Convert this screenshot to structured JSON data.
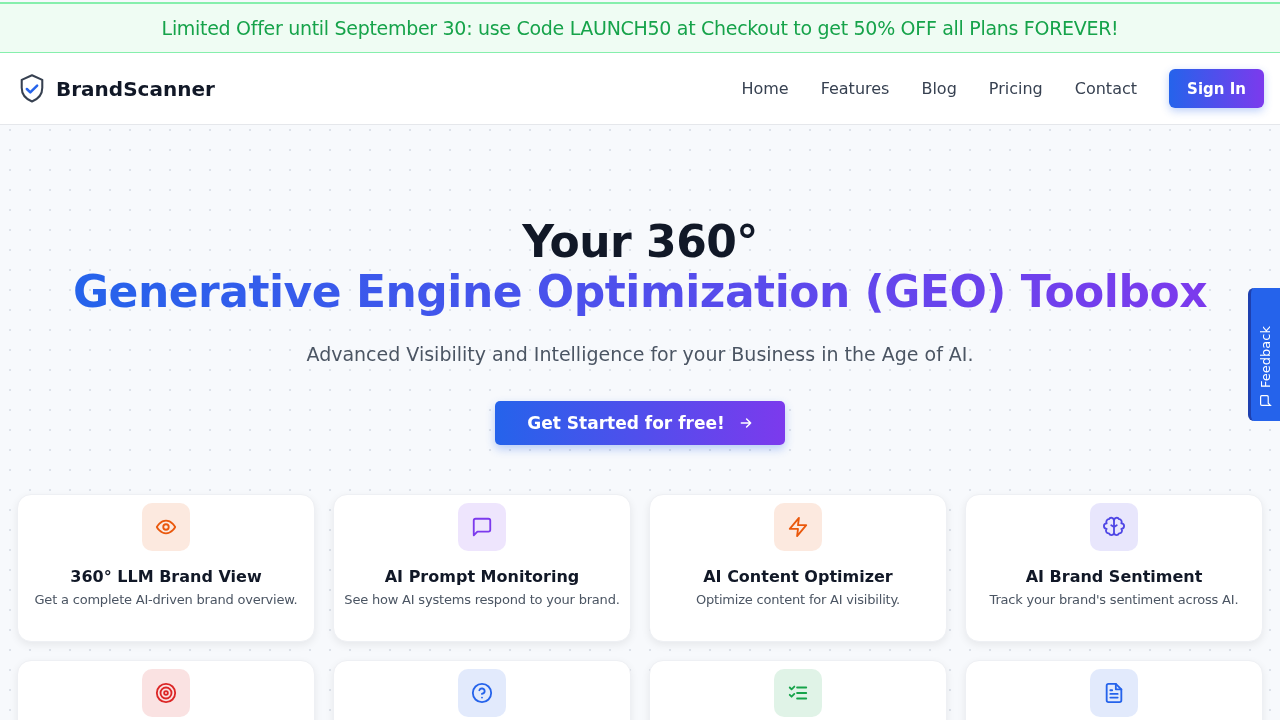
{
  "banner": {
    "text": "Limited Offer until September 30: use Code LAUNCH50 at Checkout to get 50% OFF all Plans FOREVER!"
  },
  "nav": {
    "brand": "BrandScanner",
    "links": [
      "Home",
      "Features",
      "Blog",
      "Pricing",
      "Contact"
    ],
    "button": "Sign In"
  },
  "hero": {
    "title_line_1": "Your 360°",
    "title_line_2": "Generative Engine Optimization (GEO) Toolbox",
    "subtitle": "Advanced Visibility and Intelligence for your Business in the Age of AI.",
    "cta": "Get Started for free!"
  },
  "feedback_tab": {
    "label": "Feedback"
  },
  "features": [
    {
      "kind": "eye",
      "color": "#ea580c",
      "title": "360° LLM Brand View",
      "description": "Get a complete AI-driven brand overview."
    },
    {
      "kind": "chat",
      "color": "#7c3aed",
      "title": "AI Prompt Monitoring",
      "description": "See how AI systems respond to your brand."
    },
    {
      "kind": "bolt",
      "color": "#ea580c",
      "title": "AI Content Optimizer",
      "description": "Optimize content for AI visibility."
    },
    {
      "kind": "brain",
      "color": "#4f46e5",
      "title": "AI Brand Sentiment",
      "description": "Track your brand's sentiment across AI."
    },
    {
      "kind": "target",
      "color": "#dc2626"
    },
    {
      "kind": "question",
      "color": "#2563eb"
    },
    {
      "kind": "checklist",
      "color": "#16a34a"
    },
    {
      "kind": "document",
      "color": "#2563eb"
    }
  ]
}
